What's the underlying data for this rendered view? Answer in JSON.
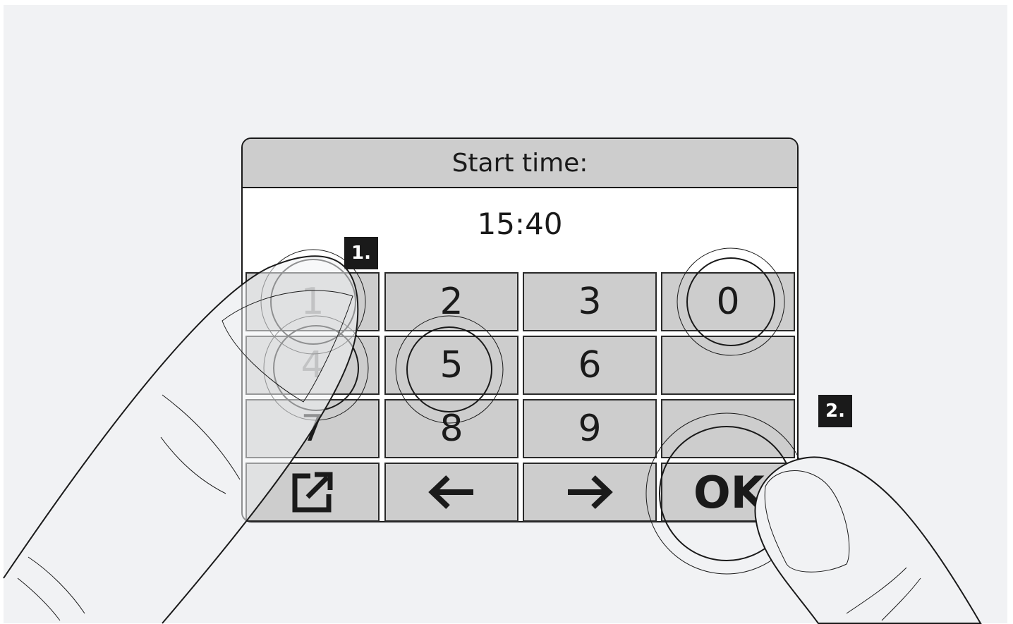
{
  "dialog": {
    "title": "Start time:",
    "time_value": "15:40"
  },
  "keypad": {
    "rows": [
      [
        "1",
        "2",
        "3",
        "0"
      ],
      [
        "4",
        "5",
        "6",
        ""
      ],
      [
        "7",
        "8",
        "9",
        ""
      ],
      [
        "export-icon",
        "arrow-left-icon",
        "arrow-right-icon",
        "OK"
      ]
    ],
    "ok_label": "OK"
  },
  "steps": {
    "step1": "1.",
    "step2": "2."
  },
  "colors": {
    "background": "#f1f2f4",
    "key_fill": "#cdcdcd",
    "outline": "#1a1a1a"
  }
}
